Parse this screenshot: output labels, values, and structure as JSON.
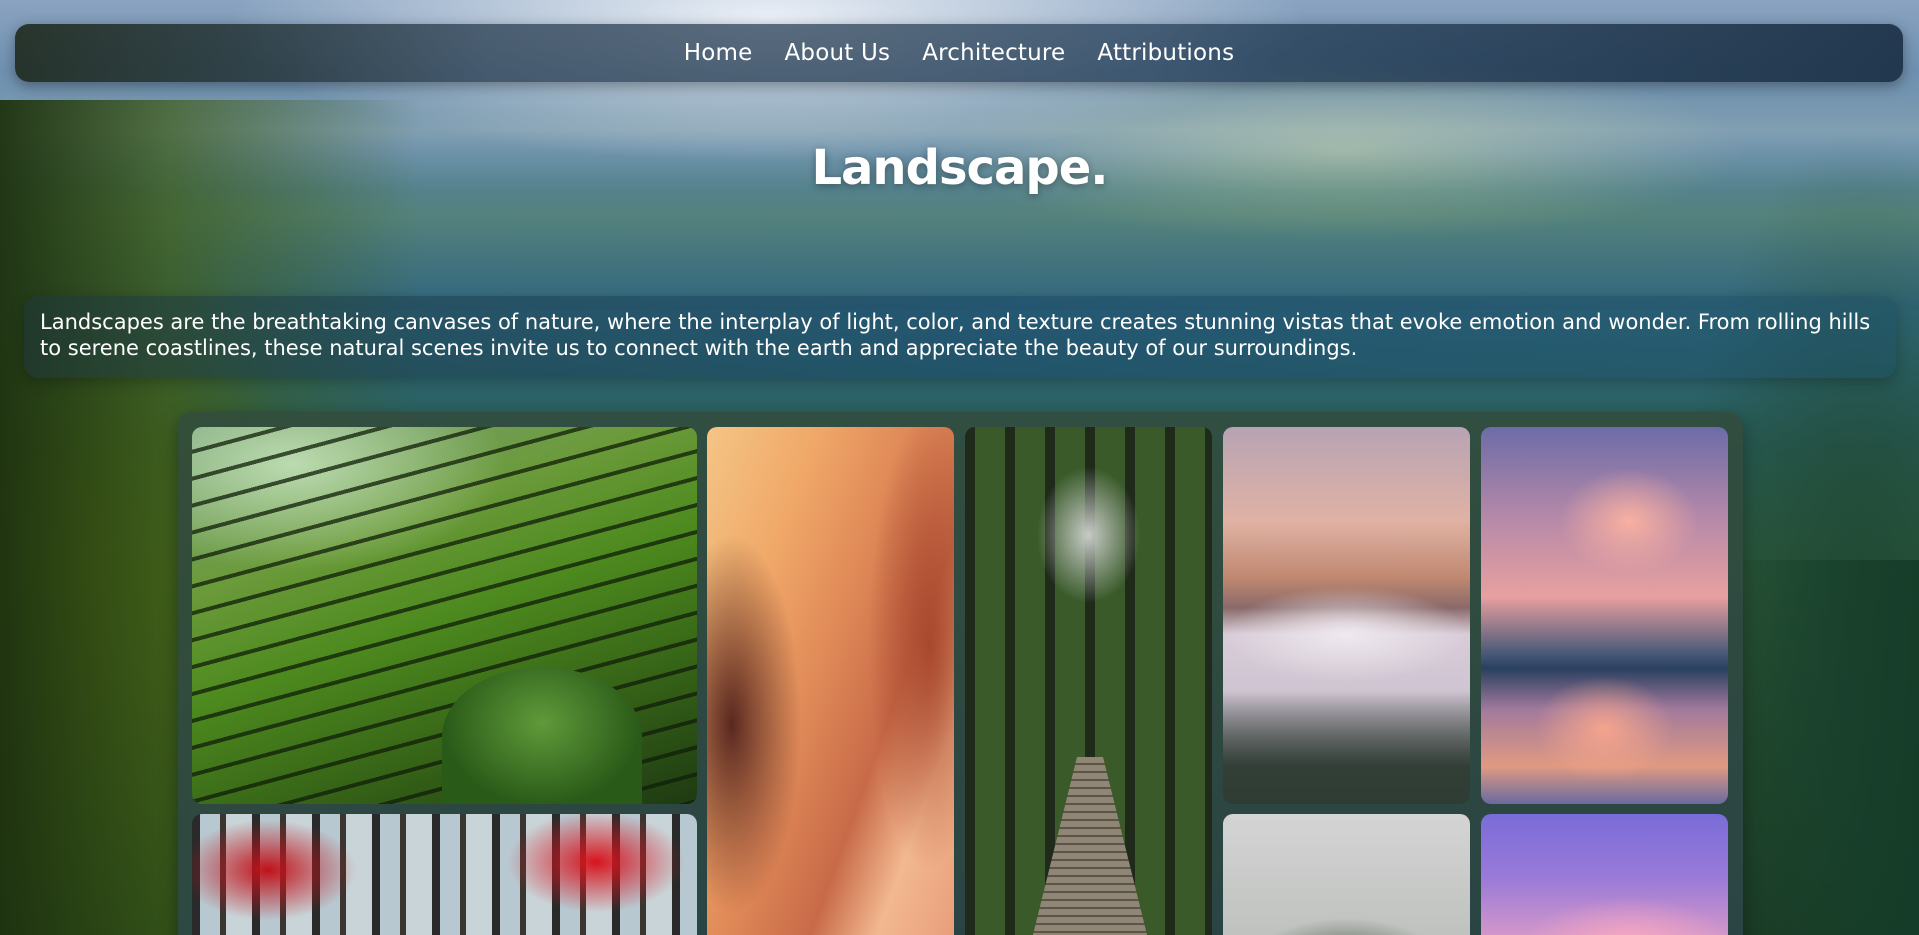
{
  "nav": {
    "links": [
      "Home",
      "About Us",
      "Architecture",
      "Attributions"
    ]
  },
  "hero": {
    "title": "Landscape."
  },
  "intro": {
    "text": "Landscapes are the breathtaking canvases of nature, where the interplay of light, color, and texture creates stunning vistas that evoke emotion and wonder. From rolling hills to serene coastlines, these natural scenes invite us to connect with the earth and appreciate the beauty of our surroundings."
  },
  "gallery": {
    "photos": [
      "rice-terraces",
      "red-forest",
      "sandstone-canyon",
      "forest-suspension-bridge",
      "misty-sunrise-mountains",
      "cloud-reflection-lake",
      "misty-pine-trees",
      "purple-sunset-sky"
    ]
  },
  "colors": {
    "nav_text": "#ffffff",
    "heading_text": "#ffffff"
  }
}
